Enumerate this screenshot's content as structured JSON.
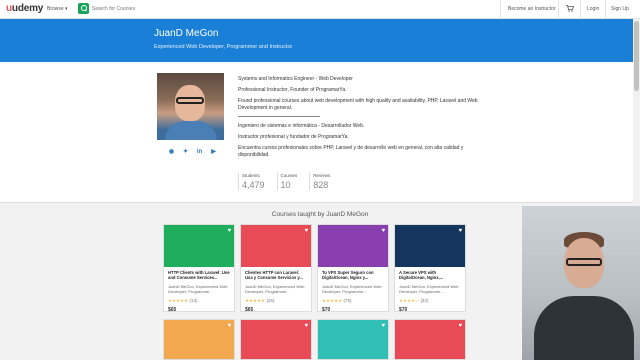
{
  "nav": {
    "logo": "udemy",
    "browse": "Browse ▾",
    "search_placeholder": "Search for Courses",
    "become_instructor": "Become an Instructor",
    "login": "Login",
    "signup": "Sign Up"
  },
  "header": {
    "name": "JuanD MeGon",
    "tagline": "Experienced Web Developer, Programmer and Instructor"
  },
  "bio": {
    "line1": "Systems and Informatics Engineer - Web Developer",
    "line2": "Professional Instructor, Founder of ProgramarYa.",
    "line3": "Found professional courses about web development with high quality and availability, PHP, Laravel and Web Development in general.",
    "line4": "Ingeniero de sistemas e informática - Desarrollador Web.",
    "line5": "Instructor profesional y fundador de ProgramarYa.",
    "line6": "Encuentra cursos profesionales sobre PHP, Laravel y de desarrollo web en general, con alta calidad y disponibilidad."
  },
  "socials": [
    "globe-icon",
    "twitter-icon",
    "linkedin-icon",
    "youtube-icon"
  ],
  "stats": [
    {
      "label": "Students",
      "value": "4,479"
    },
    {
      "label": "Courses",
      "value": "10"
    },
    {
      "label": "Reviews",
      "value": "828"
    }
  ],
  "courses_title": "Courses taught by JuanD MeGon",
  "courses": [
    {
      "title": "HTTP Clients with Laravel: Use and Consume Services...",
      "author": "JuanD MeGon, Experienced Web Developer, Programme...",
      "stars": "★★★★★",
      "count": "(13)",
      "price": "$65",
      "color": "#1fae5b"
    },
    {
      "title": "Clientes HTTP con Laravel: Usa y Consume Servicios y...",
      "author": "JuanD MeGon, Experienced Web Developer, Programme...",
      "stars": "★★★★★",
      "count": "(25)",
      "price": "$65",
      "color": "#e84b55"
    },
    {
      "title": "Tu VPS Super Seguro con DigitalOcean, Nginx y...",
      "author": "JuanD MeGon, Experienced Web Developer, Programme...",
      "stars": "★★★★★",
      "count": "(75)",
      "price": "$70",
      "color": "#8a3fb0"
    },
    {
      "title": "A Secure VPS with DigitalOcean, Nginx,...",
      "author": "JuanD MeGon, Experienced Web Developer, Programme...",
      "stars": "★★★★☆",
      "count": "(32)",
      "price": "$70",
      "color": "#14365e"
    }
  ],
  "courses_row2": [
    "#f2a84f",
    "#e84b55",
    "#2fbfb5",
    "#e84b55"
  ],
  "colors": {
    "brand": "#ec5252",
    "banner": "#1a7fd6",
    "search": "#1aa35a"
  }
}
